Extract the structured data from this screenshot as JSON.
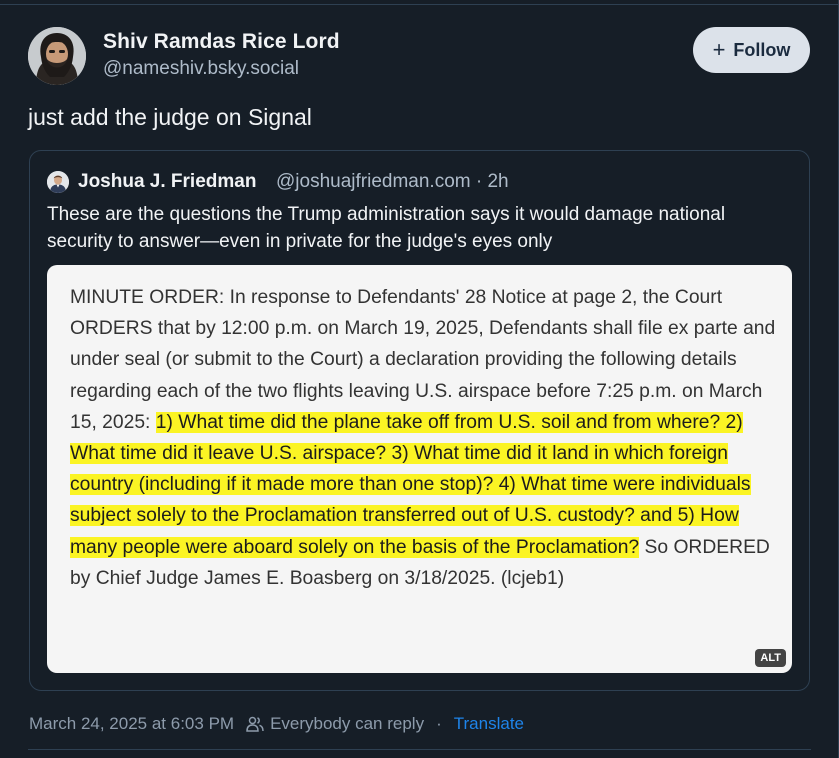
{
  "post": {
    "author_name": "Shiv Ramdas Rice Lord",
    "author_handle": "@nameshiv.bsky.social",
    "follow_label": "Follow",
    "text": "just add the judge on Signal",
    "timestamp": "March 24, 2025 at 6:03 PM",
    "reply_setting": "Everybody can reply",
    "translate_label": "Translate"
  },
  "quote": {
    "author_name": "Joshua J. Friedman",
    "author_handle": "@joshuajfriedman.com",
    "time_ago": "2h",
    "meta_separator": "·",
    "text": "These are the questions the Trump administration says it would damage national security to answer—even in private for the judge's eyes only",
    "image": {
      "pre_highlight": "MINUTE ORDER: In response to Defendants' 28 Notice at page 2, the Court ORDERS that by 12:00 p.m. on March 19, 2025, Defendants shall file ex parte and under seal (or submit to the Court) a declaration providing the following details regarding each of the two flights leaving U.S. airspace before 7:25 p.m. on March 15, 2025: ",
      "highlighted": "1) What time did the plane take off from U.S. soil and from where? 2) What time did it leave U.S. airspace? 3) What time did it land in which foreign country (including if it made more than one stop)? 4) What time were individuals subject solely to the Proclamation transferred out of U.S. custody? and 5) How many people were aboard solely on the basis of the Proclamation?",
      "post_highlight": " So ORDERED by Chief Judge James E. Boasberg on 3/18/2025. (lcjeb1)",
      "alt_badge": "ALT"
    }
  },
  "colors": {
    "background": "#161e27",
    "border": "#2e4052",
    "muted_text": "#aebbc9",
    "link": "#1e84ea",
    "highlight": "#fbf424",
    "follow_button_bg": "#dce2ea"
  },
  "icons": {
    "follow": "plus-icon",
    "reply_setting": "people-icon"
  }
}
